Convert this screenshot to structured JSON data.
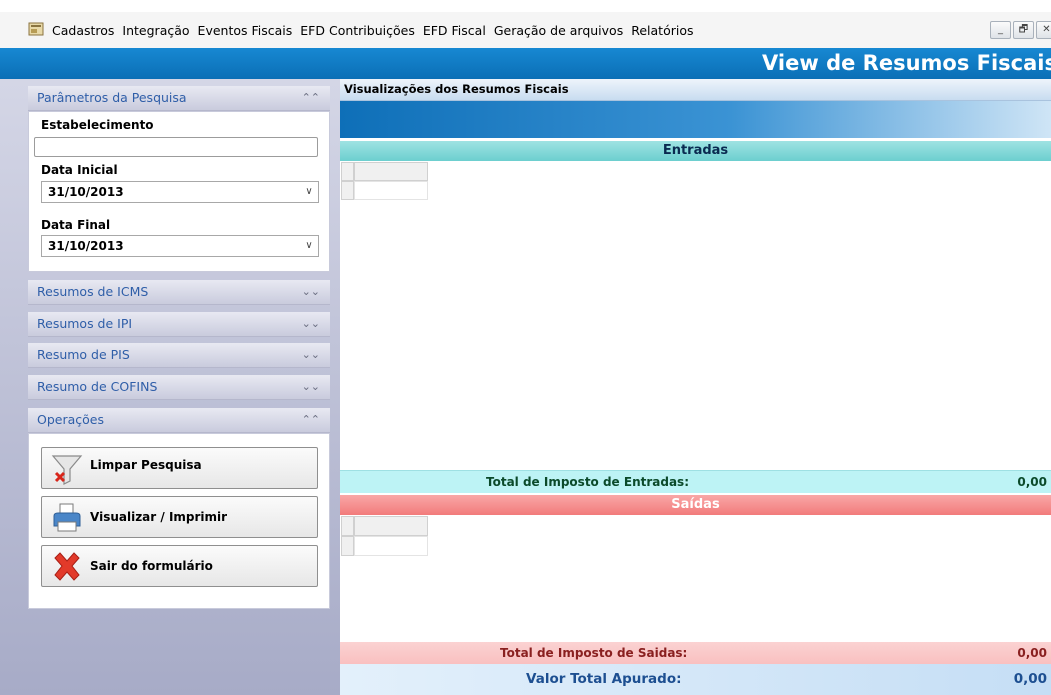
{
  "menu": {
    "items": [
      "Cadastros",
      "Integração",
      "Eventos Fiscais",
      "EFD Contribuições",
      "EFD Fiscal",
      "Geração de arquivos",
      "Relatórios"
    ],
    "window_buttons": [
      "_",
      "🗗",
      "✕"
    ]
  },
  "window": {
    "title": "View de Resumos Fiscais"
  },
  "sidebar": {
    "search_panel": {
      "title": "Parâmetros da Pesquisa",
      "estabelecimento_label": "Estabelecimento",
      "estabelecimento_value": "",
      "data_inicial_label": "Data Inicial",
      "data_inicial_value": "31/10/2013",
      "data_final_label": "Data Final",
      "data_final_value": "31/10/2013"
    },
    "sections": [
      "Resumos de ICMS",
      "Resumos de IPI",
      "Resumo de PIS",
      "Resumo de COFINS"
    ],
    "operations": {
      "title": "Operações",
      "buttons": [
        "Limpar Pesquisa",
        "Visualizar / Imprimir",
        "Sair do formulário"
      ]
    }
  },
  "main": {
    "view_title": "Visualizações dos Resumos Fiscais",
    "entradas": {
      "header": "Entradas",
      "total_label": "Total de Imposto de Entradas:",
      "total_value": "0,00"
    },
    "saidas": {
      "header": "Saídas",
      "total_label": "Total de Imposto de Saidas:",
      "total_value": "0,00"
    },
    "valor_total": {
      "label": "Valor Total Apurado:",
      "value": "0,00"
    }
  },
  "colors": {
    "title_blue": "#0b6fb6",
    "entradas_teal": "#6ccfcf",
    "saidas_red": "#f27b7b",
    "sidebar_link": "#2f5ea8"
  }
}
